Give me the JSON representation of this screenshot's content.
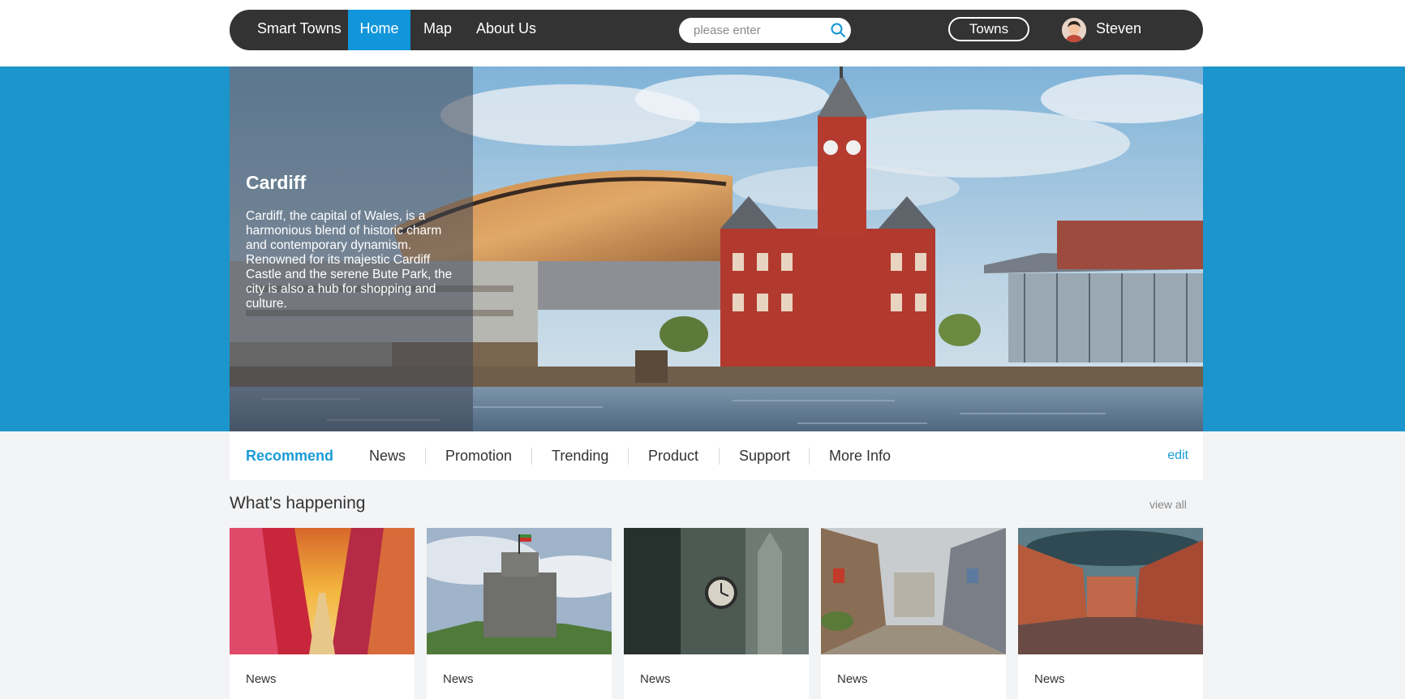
{
  "nav": {
    "brand": "Smart Towns",
    "items": [
      "Home",
      "Map",
      "About Us"
    ],
    "active": "Home",
    "search_placeholder": "please enter",
    "towns_button": "Towns",
    "user_name": "Steven"
  },
  "hero": {
    "title": "Cardiff",
    "description": "Cardiff, the capital of Wales, is a harmonious blend of historic charm and contemporary dynamism. Renowned for its majestic Cardiff Castle and the serene Bute Park, the city is also a hub for shopping and culture."
  },
  "tabs": {
    "items": [
      "Recommend",
      "News",
      "Promotion",
      "Trending",
      "Product",
      "Support",
      "More Info"
    ],
    "active": "Recommend",
    "edit_label": "edit"
  },
  "section": {
    "title": "What's happening",
    "view_all": "view all",
    "cards": [
      {
        "tag": "News"
      },
      {
        "tag": "News"
      },
      {
        "tag": "News"
      },
      {
        "tag": "News"
      },
      {
        "tag": "News"
      }
    ]
  },
  "colors": {
    "nav_bg": "#333333",
    "accent": "#1196db",
    "hero_band": "#1b95cb",
    "page_bg": "#f3f4f6"
  },
  "icons": [
    "search-icon",
    "user-avatar"
  ]
}
